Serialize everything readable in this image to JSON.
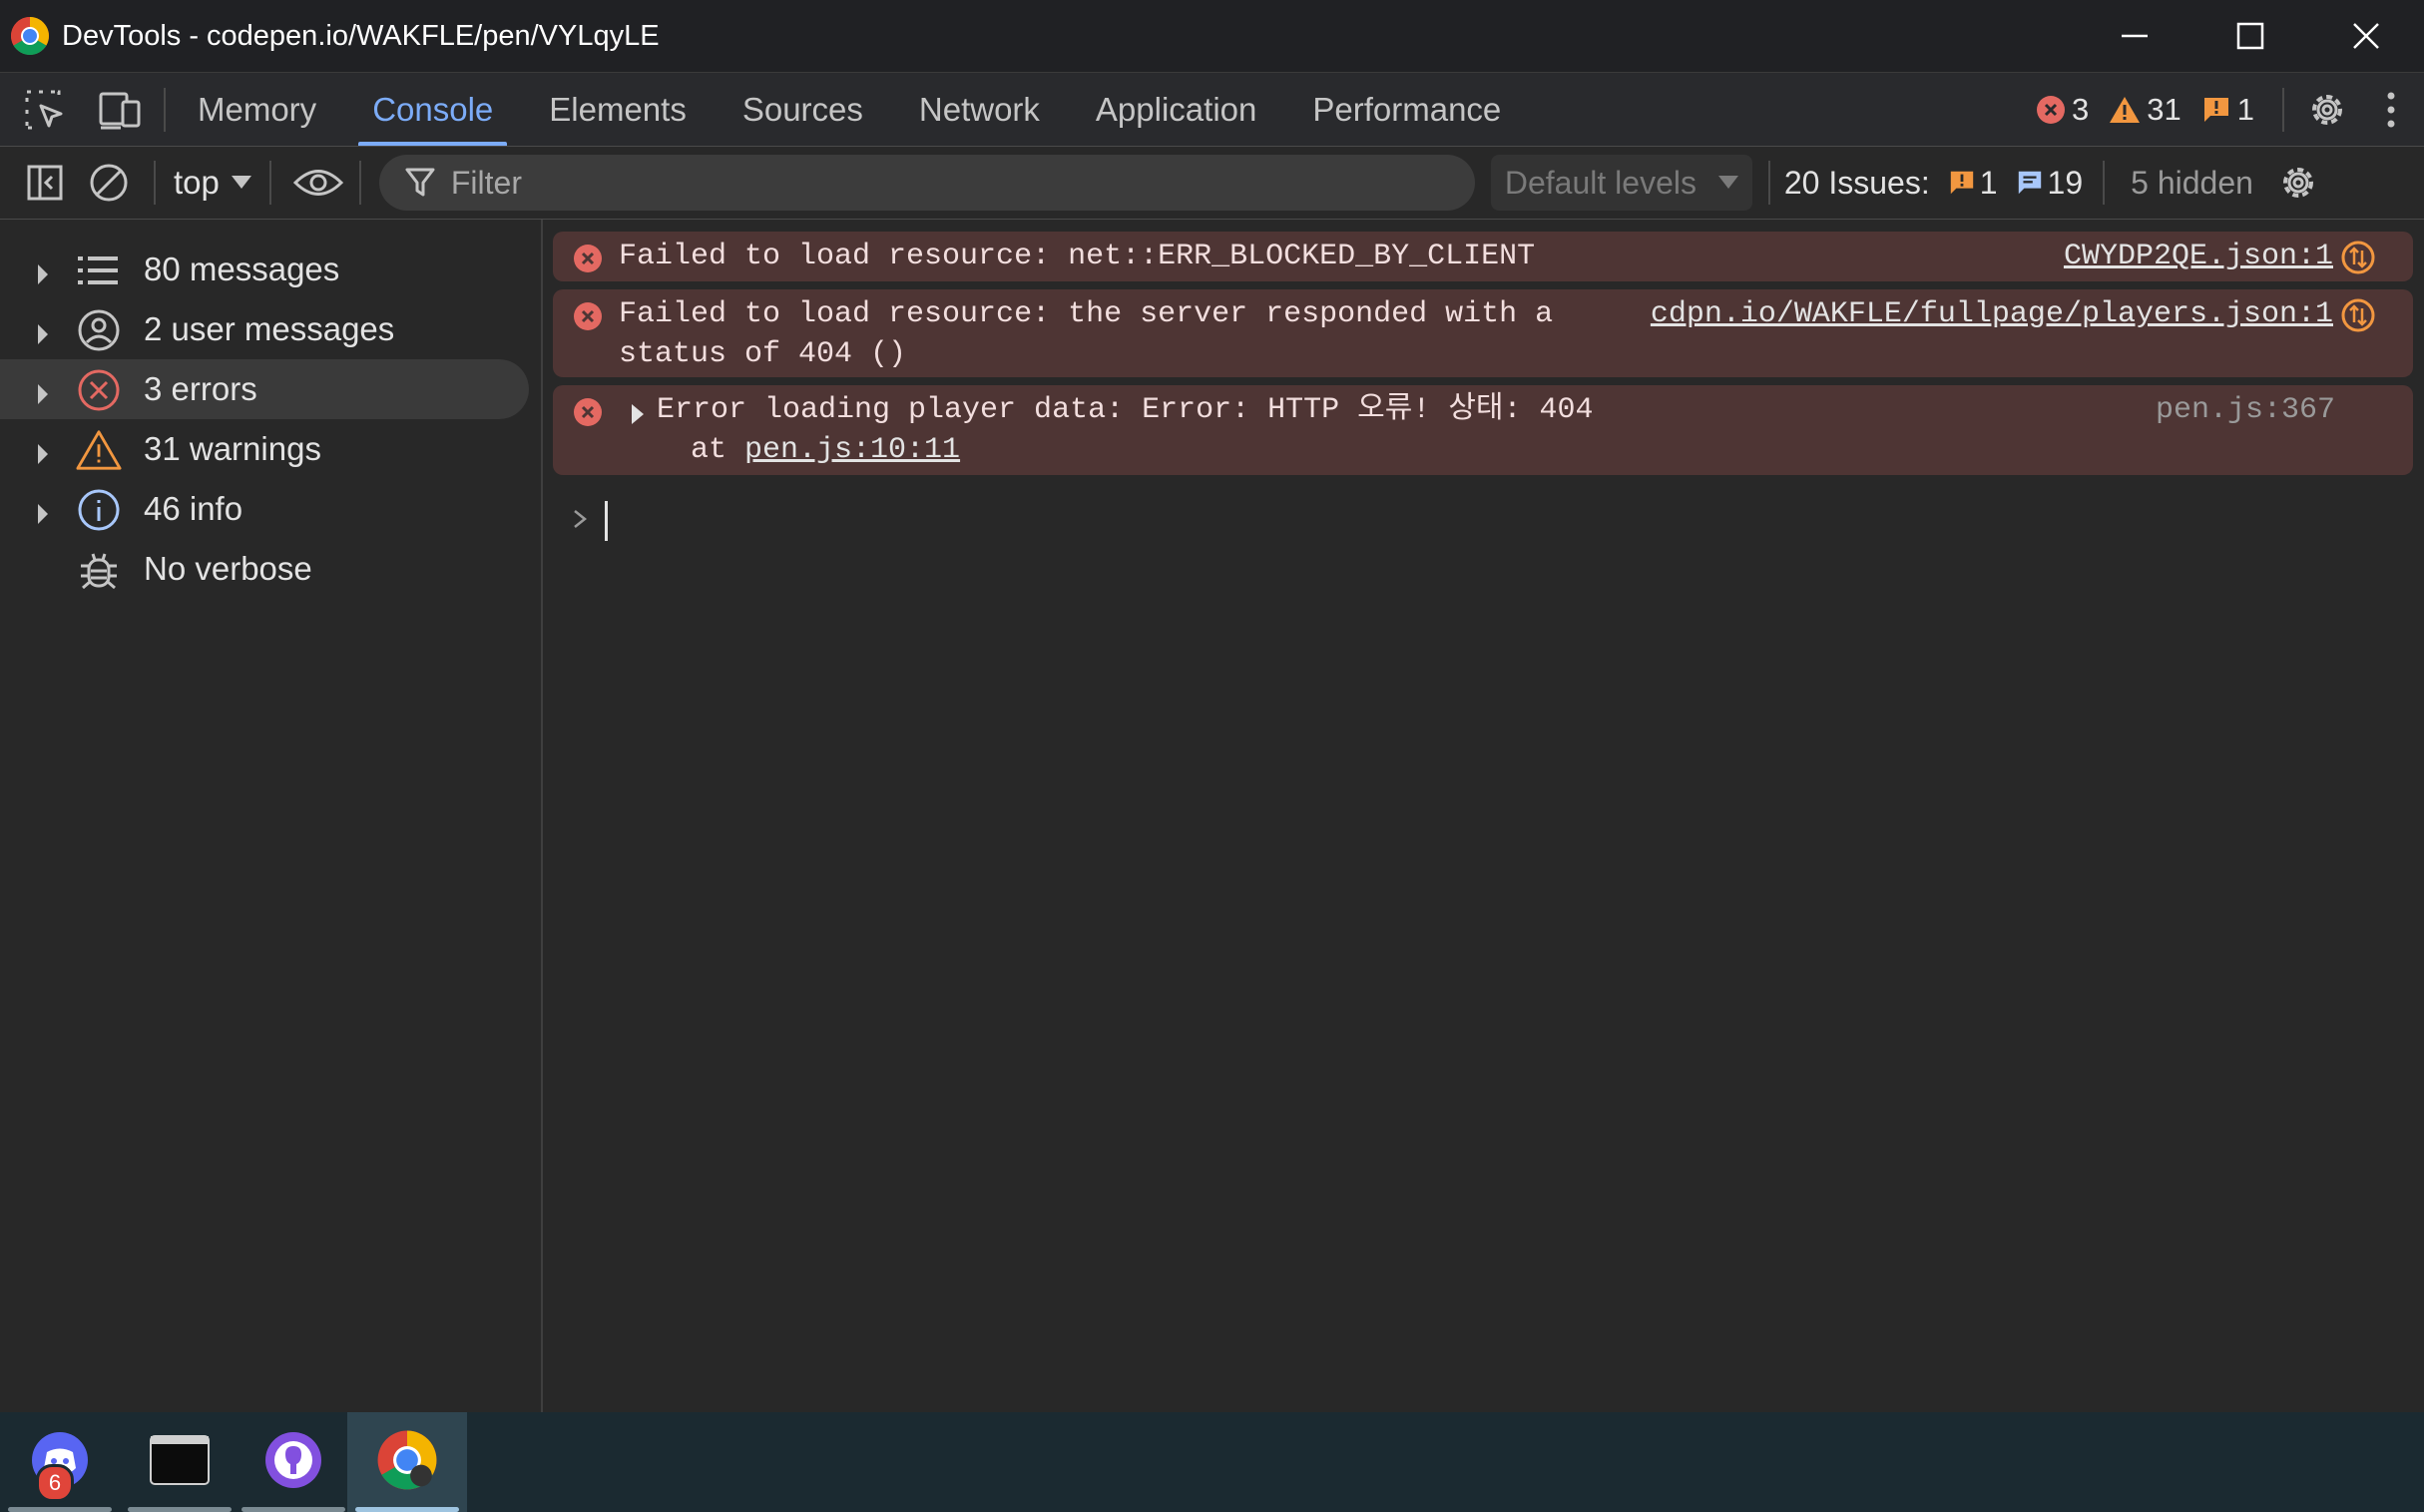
{
  "window": {
    "title": "DevTools - codepen.io/WAKFLE/pen/VYLqyLE"
  },
  "tabs": [
    {
      "label": "Memory",
      "active": false
    },
    {
      "label": "Console",
      "active": true
    },
    {
      "label": "Elements",
      "active": false
    },
    {
      "label": "Sources",
      "active": false
    },
    {
      "label": "Network",
      "active": false
    },
    {
      "label": "Application",
      "active": false
    },
    {
      "label": "Performance",
      "active": false
    }
  ],
  "counts": {
    "errors": "3",
    "warnings": "31",
    "issues": "1"
  },
  "toolbar": {
    "context": "top",
    "filter_placeholder": "Filter",
    "levels": "Default levels",
    "issues_label": "20 Issues:",
    "issues_warn": "1",
    "issues_info": "19",
    "hidden": "5 hidden"
  },
  "sidebar": {
    "items": [
      {
        "label": "80 messages",
        "icon": "list-icon"
      },
      {
        "label": "2 user messages",
        "icon": "user-icon"
      },
      {
        "label": "3 errors",
        "icon": "error-icon",
        "selected": true
      },
      {
        "label": "31 warnings",
        "icon": "warning-icon"
      },
      {
        "label": "46 info",
        "icon": "info-icon"
      },
      {
        "label": "No verbose",
        "icon": "bug-icon"
      }
    ]
  },
  "console": {
    "messages": [
      {
        "text": "Failed to load resource: net::ERR_BLOCKED_BY_CLIENT",
        "source": "CWYDP2QE.json:1"
      },
      {
        "line1": "Failed to load resource: the server responded with a",
        "line2": "status of 404 ()",
        "source": "cdpn.io/WAKFLE/fullpage/players.json:1"
      },
      {
        "line1": "Error loading player data: Error: HTTP 오류! 상태: 404",
        "line2_prefix": "at ",
        "line2_link": "pen.js:10:11",
        "source": "pen.js:367"
      }
    ]
  },
  "taskbar": {
    "discord_badge": "6"
  },
  "colors": {
    "accent": "#7cacf8",
    "error": "#e46962",
    "warning": "#f29740",
    "error_row_bg": "#4e3534"
  }
}
